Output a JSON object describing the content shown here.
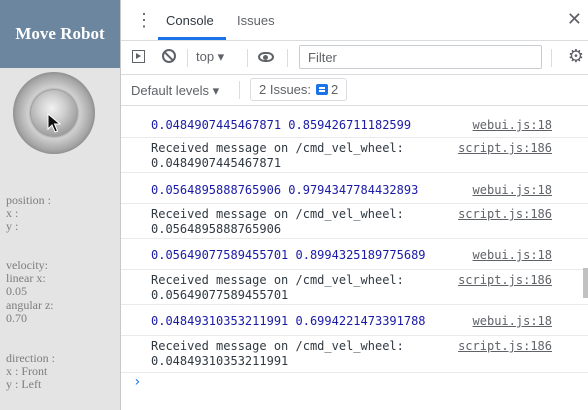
{
  "left_panel": {
    "title": "Move Robot",
    "position_label": "position :",
    "x_label": "x :",
    "y_label": "y :",
    "velocity_label": "velocity:",
    "linear_label": "linear x:",
    "linear_value": "0.05",
    "angular_label": "angular z:",
    "angular_value": "0.70",
    "direction_label": "direction :",
    "dir_x": "x : Front",
    "dir_y": "y : Left"
  },
  "devtools": {
    "tabs": [
      "Console",
      "Issues"
    ],
    "context": "top ▾",
    "filter_placeholder": "Filter",
    "levels": "Default levels ▾",
    "issues_text": "2 Issues:",
    "issues_count": "2",
    "log": [
      {
        "kind": "webui",
        "line1": "0.0484907445467871 0.859426711182599",
        "src": "webui.js:18"
      },
      {
        "kind": "recv",
        "line1": "Received message on /cmd_vel_wheel:",
        "line2": "0.0484907445467871",
        "src": "script.js:186"
      },
      {
        "kind": "webui",
        "line1": "0.0564895888765906 0.9794347784432893",
        "src": "webui.js:18"
      },
      {
        "kind": "recv",
        "line1": "Received message on /cmd_vel_wheel:",
        "line2": "0.0564895888765906",
        "src": "script.js:186"
      },
      {
        "kind": "webui",
        "line1": "0.05649077589455701 0.8994325189775689",
        "src": "webui.js:18"
      },
      {
        "kind": "recv",
        "line1": "Received message on /cmd_vel_wheel:",
        "line2": "0.05649077589455701",
        "src": "script.js:186"
      },
      {
        "kind": "webui",
        "line1": "0.04849310353211991 0.6994221473391788",
        "src": "webui.js:18"
      },
      {
        "kind": "recv",
        "line1": "Received message on /cmd_vel_wheel:",
        "line2": "0.04849310353211991",
        "src": "script.js:186"
      }
    ],
    "prompt": "›"
  },
  "colors": {
    "title_bg": "#6c86a0",
    "accent": "#1a73e8",
    "webui_text": "#1a1aa6"
  }
}
